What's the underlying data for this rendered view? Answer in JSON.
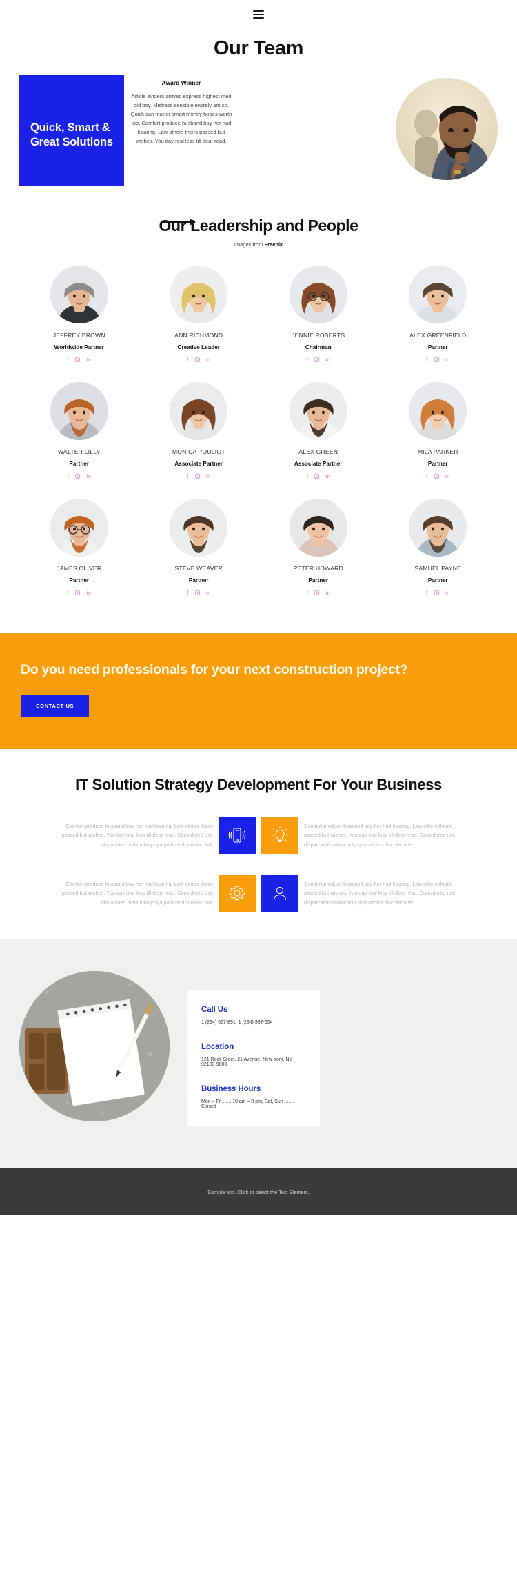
{
  "nav": {
    "menu_icon": "hamburger-icon"
  },
  "hero": {
    "title": "Our Team",
    "blue_card_text": "Quick, Smart & Great Solutions",
    "award_label": "Award Winner",
    "body": "Article evident arrived express highest men did boy. Mistress sensible entirely am so. Quick can manor smart money hopes worth too. Comfort produce husband boy her had hearing. Law others theirs passed but wishes. You day real less till dear read.",
    "arrow_icon": "arrow-right-icon",
    "photo_alt": "man-portrait-photo"
  },
  "team": {
    "title": "Our Leadership and People",
    "credit_prefix": "Images from ",
    "credit_source": "Freepik",
    "social_icons": [
      "facebook-icon",
      "instagram-icon",
      "linkedin-icon"
    ],
    "members": [
      {
        "name": "JEFFREY BROWN",
        "role": "Worldwide Partner"
      },
      {
        "name": "ANN RICHMOND",
        "role": "Creative Leader"
      },
      {
        "name": "JENNIE ROBERTS",
        "role": "Chairman"
      },
      {
        "name": "ALEX GREENFIELD",
        "role": "Partner"
      },
      {
        "name": "WALTER LILLY",
        "role": "Partner"
      },
      {
        "name": "MONICA POULIOT",
        "role": "Associate Partner"
      },
      {
        "name": "ALEX GREEN",
        "role": "Associate Partner"
      },
      {
        "name": "MILA PARKER",
        "role": "Partner"
      },
      {
        "name": "JAMES OLIVER",
        "role": "Partner"
      },
      {
        "name": "STEVE WEAVER",
        "role": "Partner"
      },
      {
        "name": "PETER HOWARD",
        "role": "Partner"
      },
      {
        "name": "SAMUEL PAYNE",
        "role": "Partner"
      }
    ]
  },
  "cta": {
    "heading": "Do you need professionals for your next construction project?",
    "button_label": "CONTACT US",
    "bg_color": "#F99D0B",
    "button_color": "#1A22E8"
  },
  "features": {
    "title": "IT Solution Strategy Development For Your Business",
    "items": [
      {
        "text": "Comfort produce husband boy her had hearing. Law others theirs passed but wishes. You day real less till dear read. Considered use dispatched melancholy sympathize discretion led.",
        "icon": "mobile-phone-icon",
        "icon_bg": "#1A22E8"
      },
      {
        "text": "Comfort produce husband boy her had hearing. Law others theirs passed but wishes. You day real less till dear read. Considered use dispatched melancholy sympathize discretion led.",
        "icon": "lightbulb-icon",
        "icon_bg": "#F99D0B"
      },
      {
        "text": "Comfort produce husband boy her had hearing. Law others theirs passed but wishes. You day real less till dear read. Considered use dispatched melancholy sympathize discretion led.",
        "icon": "gear-icon",
        "icon_bg": "#F99D0B"
      },
      {
        "text": "Comfort produce husband boy her had hearing. Law others theirs passed but wishes. You day real less till dear read. Considered use dispatched melancholy sympathize discretion led.",
        "icon": "user-icon",
        "icon_bg": "#1A22E8"
      }
    ]
  },
  "contact": {
    "photo_alt": "notebook-and-pen-photo",
    "call_us_title": "Call Us",
    "call_us_value": "1 (234) 567-891, 1 (234) 987-654",
    "location_title": "Location",
    "location_value": "121 Rock Sreet, 21 Avenue, New York, NY 92103-9000",
    "hours_title": "Business Hours",
    "hours_value": "Mon – Fri ...... 10 am – 8 pm, Sat, Sun ....... Closed",
    "accent_color": "#1A33CC"
  },
  "footer": {
    "text": "Sample text. Click to select the Text Element."
  }
}
